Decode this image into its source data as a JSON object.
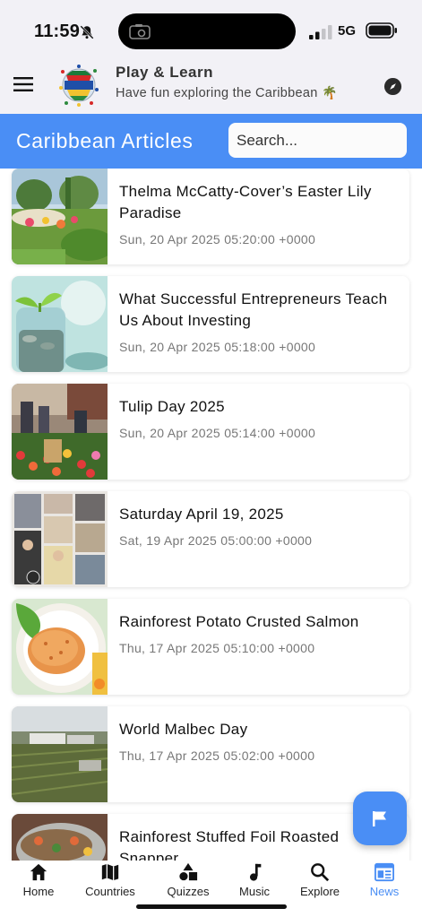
{
  "status_bar": {
    "time": "11:59",
    "network": "5G"
  },
  "app": {
    "title": "Play & Learn",
    "subtitle": "Have fun exploring the Caribbean",
    "subtitle_emoji": "🌴"
  },
  "section": {
    "title": "Caribbean Articles",
    "search_placeholder": "Search...",
    "search_value": ""
  },
  "articles": [
    {
      "title": "Thelma McCatty-Cover’s Easter Lily Paradise",
      "date": "Sun, 20 Apr 2025 05:20:00 +0000",
      "image": "garden"
    },
    {
      "title": "What Successful Entrepreneurs Teach Us About Investing",
      "date": "Sun, 20 Apr 2025 05:18:00 +0000",
      "image": "coin-jar"
    },
    {
      "title": "Tulip Day 2025",
      "date": "Sun, 20 Apr 2025 05:14:00 +0000",
      "image": "tulips"
    },
    {
      "title": "Saturday April 19, 2025",
      "date": "Sat, 19 Apr 2025 05:00:00 +0000",
      "image": "collage"
    },
    {
      "title": "Rainforest Potato Crusted Salmon",
      "date": "Thu, 17 Apr 2025 05:10:00 +0000",
      "image": "salmon"
    },
    {
      "title": "World Malbec Day",
      "date": "Thu, 17 Apr 2025 05:02:00 +0000",
      "image": "vineyard"
    },
    {
      "title": "Rainforest Stuffed Foil Roasted Snapper",
      "date": "",
      "image": "snapper"
    }
  ],
  "fab": {
    "icon": "flag-icon"
  },
  "nav": [
    {
      "label": "Home",
      "icon": "home-icon",
      "active": false
    },
    {
      "label": "Countries",
      "icon": "map-icon",
      "active": false
    },
    {
      "label": "Quizzes",
      "icon": "shapes-icon",
      "active": false
    },
    {
      "label": "Music",
      "icon": "music-note-icon",
      "active": false
    },
    {
      "label": "Explore",
      "icon": "search-icon",
      "active": false
    },
    {
      "label": "News",
      "icon": "newspaper-icon",
      "active": true
    }
  ],
  "colors": {
    "accent": "#4a8ef5",
    "header_bg": "#f2f1f6",
    "date_text": "#777777"
  }
}
